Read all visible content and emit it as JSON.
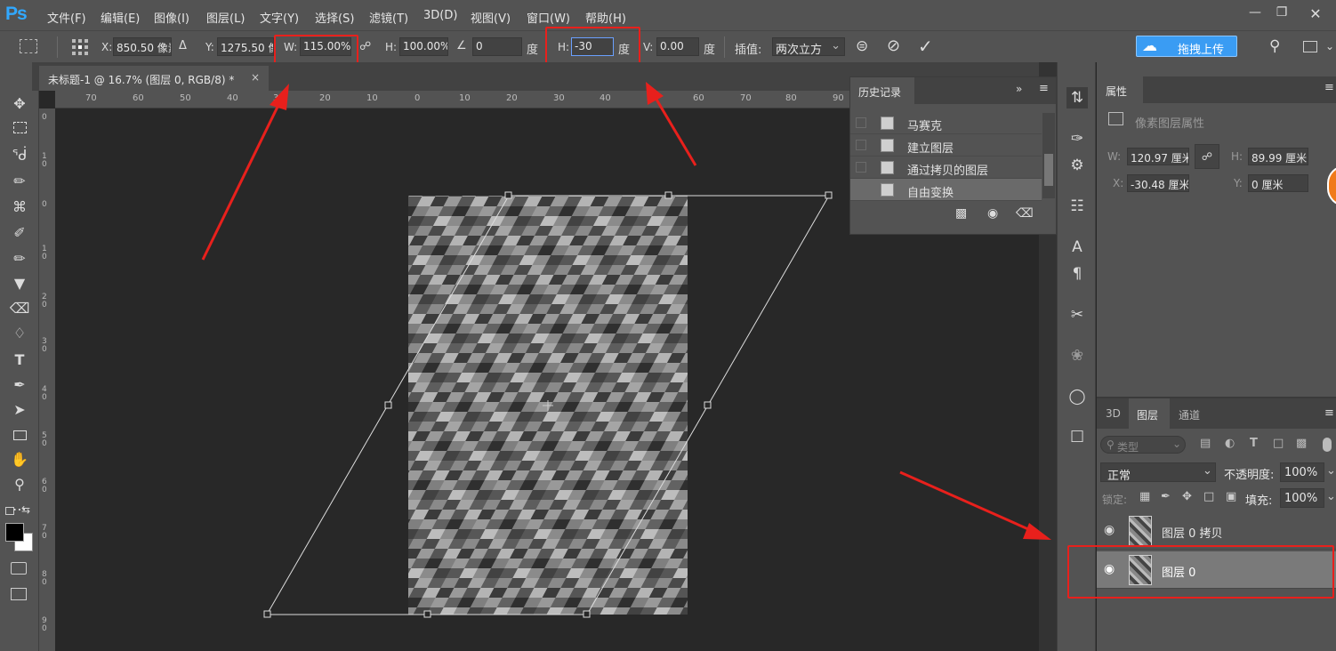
{
  "app": {
    "logo": "Ps",
    "menu": [
      "文件(F)",
      "编辑(E)",
      "图像(I)",
      "图层(L)",
      "文字(Y)",
      "选择(S)",
      "滤镜(T)",
      "3D(D)",
      "视图(V)",
      "窗口(W)",
      "帮助(H)"
    ]
  },
  "options": {
    "x_label": "X:",
    "x_value": "850.50 像素",
    "y_label": "Y:",
    "y_value": "1275.50 像",
    "w_label": "W:",
    "w_value": "115.00%",
    "h_label": "H:",
    "h_value": "100.00%",
    "angle_value": "0",
    "deg1": "度",
    "skew_h_label": "H:",
    "skew_h_value": "-30",
    "deg2": "度",
    "skew_v_label": "V:",
    "skew_v_value": "0.00",
    "deg3": "度",
    "interp_label": "插值:",
    "interp_value": "两次立方",
    "upload_label": "拖拽上传"
  },
  "document": {
    "tab_title": "未标题-1 @ 16.7% (图层 0, RGB/8) *",
    "ruler_top": [
      "70",
      "60",
      "50",
      "40",
      "30",
      "20",
      "10",
      "0",
      "10",
      "20",
      "30",
      "40",
      "50",
      "60",
      "70",
      "80",
      "90"
    ],
    "ruler_left": [
      "0",
      "1 0",
      "0",
      "1 0",
      "2 0",
      "3 0",
      "4 0",
      "5 0",
      "6 0",
      "7 0",
      "8 0",
      "9 0"
    ]
  },
  "history": {
    "title": "历史记录",
    "items": [
      "马赛克",
      "建立图层",
      "通过拷贝的图层",
      "自由变换"
    ]
  },
  "properties": {
    "title": "属性",
    "subtitle": "像素图层属性",
    "w_label": "W:",
    "w_value": "120.97 厘米",
    "h_label": "H:",
    "h_value": "89.99 厘米",
    "x_label": "X:",
    "x_value": "-30.48 厘米",
    "y_label": "Y:",
    "y_value": "0 厘米"
  },
  "layers": {
    "tabs": [
      "3D",
      "图层",
      "通道"
    ],
    "filter_placeholder": "类型",
    "blend_mode": "正常",
    "opacity_label": "不透明度:",
    "opacity_value": "100%",
    "lock_label": "锁定:",
    "fill_label": "填充:",
    "fill_value": "100%",
    "items": [
      "图层 0 拷贝",
      "图层 0"
    ]
  },
  "colors": {
    "annotation_red": "#e8201c",
    "ps_blue": "#31a8ff",
    "panel_bg": "#535353",
    "canvas_bg": "#282828"
  }
}
